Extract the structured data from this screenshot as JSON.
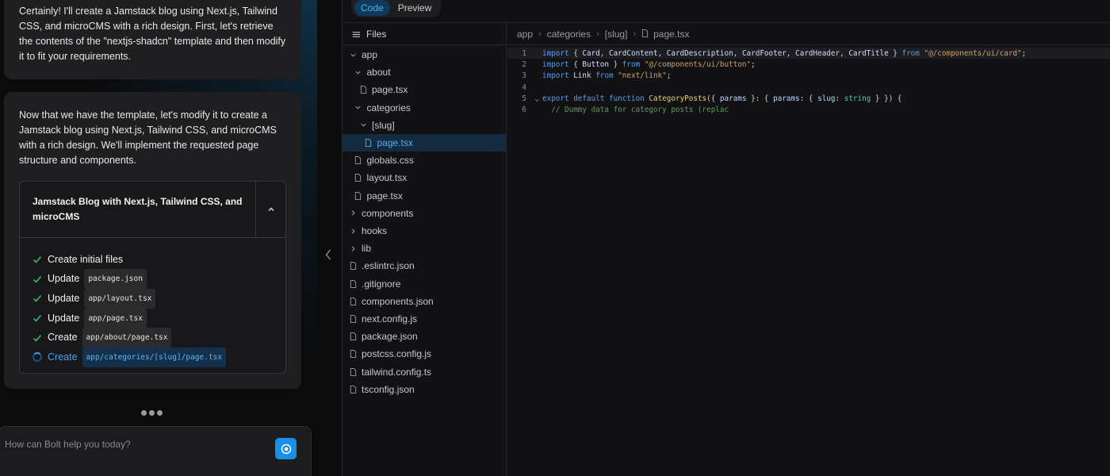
{
  "chat": {
    "message1": "Certainly! I'll create a Jamstack blog using Next.js, Tailwind CSS, and microCMS with a rich design. First, let's retrieve the contents of the \"nextjs-shadcn\" template and then modify it to fit your requirements.",
    "message2": "Now that we have the template, let's modify it to create a Jamstack blog using Next.js, Tailwind CSS, and microCMS with a rich design. We'll implement the requested page structure and components.",
    "artifact": {
      "title": "Jamstack Blog with Next.js, Tailwind CSS, and microCMS",
      "steps": [
        {
          "verb": "Create initial files",
          "file": "",
          "status": "done"
        },
        {
          "verb": "Update",
          "file": "package.json",
          "status": "done"
        },
        {
          "verb": "Update",
          "file": "app/layout.tsx",
          "status": "done"
        },
        {
          "verb": "Update",
          "file": "app/page.tsx",
          "status": "done"
        },
        {
          "verb": "Create",
          "file": "app/about/page.tsx",
          "status": "done"
        },
        {
          "verb": "Create",
          "file": "app/categories/[slug]/page.tsx",
          "status": "running"
        }
      ]
    },
    "input": {
      "placeholder": "How can Bolt help you today?"
    }
  },
  "workbench": {
    "tabs": [
      "Code",
      "Preview"
    ],
    "active_tab": "Code",
    "files_title": "Files",
    "tree": [
      {
        "label": "app",
        "type": "folder-open",
        "depth": 0
      },
      {
        "label": "about",
        "type": "folder-open",
        "depth": 1
      },
      {
        "label": "page.tsx",
        "type": "file",
        "depth": 2
      },
      {
        "label": "categories",
        "type": "folder-open",
        "depth": 1
      },
      {
        "label": "[slug]",
        "type": "folder-open",
        "depth": 2
      },
      {
        "label": "page.tsx",
        "type": "file",
        "depth": 3,
        "selected": true
      },
      {
        "label": "globals.css",
        "type": "file",
        "depth": 1
      },
      {
        "label": "layout.tsx",
        "type": "file",
        "depth": 1
      },
      {
        "label": "page.tsx",
        "type": "file",
        "depth": 1
      },
      {
        "label": "components",
        "type": "folder-closed",
        "depth": 0
      },
      {
        "label": "hooks",
        "type": "folder-closed",
        "depth": 0
      },
      {
        "label": "lib",
        "type": "folder-closed",
        "depth": 0
      },
      {
        "label": ".eslintrc.json",
        "type": "file",
        "depth": 0
      },
      {
        "label": ".gitignore",
        "type": "file",
        "depth": 0
      },
      {
        "label": "components.json",
        "type": "file",
        "depth": 0
      },
      {
        "label": "next.config.js",
        "type": "file",
        "depth": 0
      },
      {
        "label": "package.json",
        "type": "file",
        "depth": 0
      },
      {
        "label": "postcss.config.js",
        "type": "file",
        "depth": 0
      },
      {
        "label": "tailwind.config.ts",
        "type": "file",
        "depth": 0
      },
      {
        "label": "tsconfig.json",
        "type": "file",
        "depth": 0
      }
    ],
    "breadcrumb": [
      "app",
      "categories",
      "[slug]",
      "page.tsx"
    ],
    "code_lines": [
      {
        "n": "1",
        "fold": "",
        "hl": true,
        "tokens": [
          [
            "kw",
            "import"
          ],
          [
            "pl",
            " { "
          ],
          [
            "id",
            "Card"
          ],
          [
            "pl",
            ", "
          ],
          [
            "id",
            "CardContent"
          ],
          [
            "pl",
            ", "
          ],
          [
            "id",
            "CardDescription"
          ],
          [
            "pl",
            ", "
          ],
          [
            "id",
            "CardFooter"
          ],
          [
            "pl",
            ", "
          ],
          [
            "id",
            "CardHeader"
          ],
          [
            "pl",
            ", "
          ],
          [
            "id",
            "CardTitle"
          ],
          [
            "pl",
            " } "
          ],
          [
            "kw",
            "from"
          ],
          [
            "pl",
            " "
          ],
          [
            "str",
            "\"@/components/ui/card\""
          ],
          [
            "pl",
            ";"
          ]
        ]
      },
      {
        "n": "2",
        "fold": "",
        "tokens": [
          [
            "kw",
            "import"
          ],
          [
            "pl",
            " { "
          ],
          [
            "id",
            "Button"
          ],
          [
            "pl",
            " } "
          ],
          [
            "kw",
            "from"
          ],
          [
            "pl",
            " "
          ],
          [
            "str",
            "\"@/components/ui/button\""
          ],
          [
            "pl",
            ";"
          ]
        ]
      },
      {
        "n": "3",
        "fold": "",
        "tokens": [
          [
            "kw",
            "import"
          ],
          [
            "pl",
            " "
          ],
          [
            "id",
            "Link"
          ],
          [
            "pl",
            " "
          ],
          [
            "kw",
            "from"
          ],
          [
            "pl",
            " "
          ],
          [
            "str",
            "\"next/link\""
          ],
          [
            "pl",
            ";"
          ]
        ]
      },
      {
        "n": "4",
        "fold": "",
        "tokens": []
      },
      {
        "n": "5",
        "fold": "⌄",
        "tokens": [
          [
            "kw",
            "export"
          ],
          [
            "pl",
            " "
          ],
          [
            "kw",
            "default"
          ],
          [
            "pl",
            " "
          ],
          [
            "kw",
            "function"
          ],
          [
            "pl",
            " "
          ],
          [
            "fn",
            "CategoryPosts"
          ],
          [
            "pl",
            "({ "
          ],
          [
            "pa",
            "params"
          ],
          [
            "pl",
            " }: { "
          ],
          [
            "pa",
            "params"
          ],
          [
            "pl",
            ": { "
          ],
          [
            "pa",
            "slug"
          ],
          [
            "pl",
            ": "
          ],
          [
            "ty",
            "string"
          ],
          [
            "pl",
            " } }) {"
          ]
        ]
      },
      {
        "n": "6",
        "fold": "",
        "tokens": [
          [
            "pl",
            "  "
          ],
          [
            "cm",
            "// Dummy data for category posts (replac"
          ]
        ]
      }
    ]
  }
}
